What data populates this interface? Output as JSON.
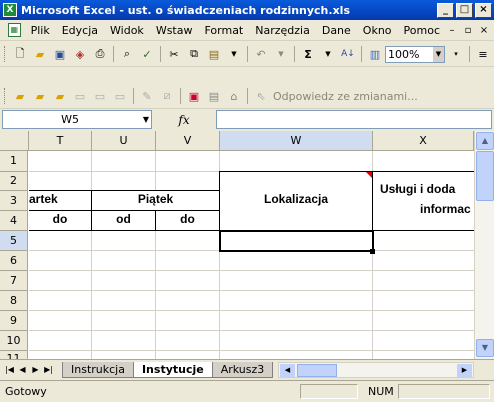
{
  "window": {
    "title": "Microsoft Excel - ust. o świadczeniach rodzinnych.xls",
    "app_icon": "X",
    "controls": [
      "_",
      "□",
      "×"
    ]
  },
  "menu": {
    "items": [
      "Plik",
      "Edycja",
      "Widok",
      "Wstaw",
      "Format",
      "Narzędzia",
      "Dane",
      "Okno",
      "Pomoc"
    ],
    "doc_controls": [
      "–",
      "▫",
      "×"
    ]
  },
  "toolbar": {
    "zoom": "100%",
    "reply_with_changes": "Odpowiedz ze zmianami..."
  },
  "formula_bar": {
    "cell_reference": "W5",
    "fx_label": "fx",
    "formula": ""
  },
  "sheet": {
    "columns": [
      "T",
      "U",
      "V",
      "W",
      "X"
    ],
    "rows": [
      "1",
      "2",
      "3",
      "4",
      "5",
      "6",
      "7",
      "8",
      "9",
      "10",
      "11"
    ],
    "header_cells": {
      "t3": "artek",
      "piatek": "Piątek",
      "t4": "do",
      "u4": "od",
      "v4": "do",
      "lokalizacja": "Lokalizacja",
      "uslugi_line1": "Usługi i doda",
      "uslugi_line2": "informac"
    },
    "active_cell": "W5",
    "selected_column": "W",
    "selected_row": "5"
  },
  "tabs": {
    "items": [
      "Instrukcja",
      "Instytucje",
      "Arkusz3"
    ],
    "active": "Instytucje"
  },
  "status": {
    "text": "Gotowy",
    "num": "NUM"
  }
}
